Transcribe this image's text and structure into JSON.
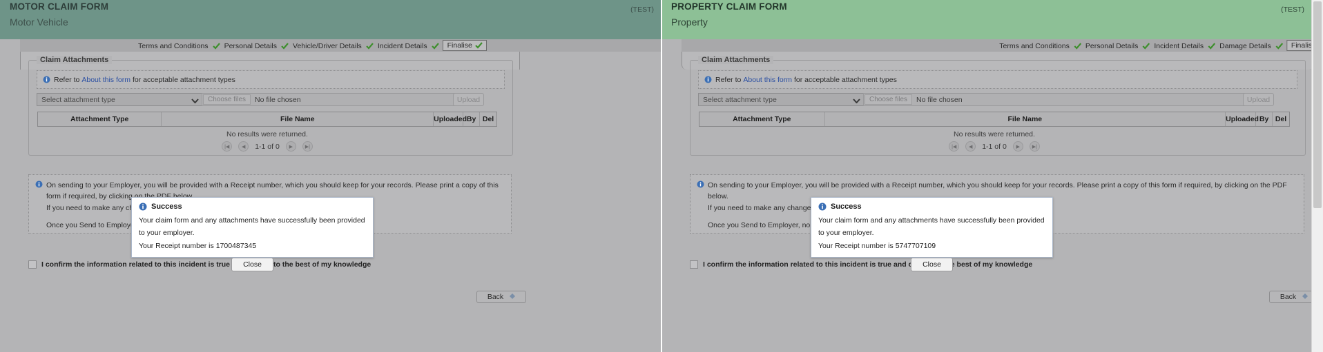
{
  "colors": {
    "motor_header": "#6e9488",
    "property_header": "#8dc096",
    "page_bg": "#b4b4b6",
    "link": "#2b4fa2",
    "tick_green": "#3f8f2e",
    "info_blue": "#3b6fb5"
  },
  "panes": [
    {
      "id": "motor",
      "header": {
        "title": "MOTOR CLAIM FORM",
        "subtitle": "Motor Vehicle",
        "environment_flag": "(TEST)"
      },
      "breadcrumb": {
        "steps": [
          {
            "label": "Terms and Conditions",
            "completed": true,
            "active": false
          },
          {
            "label": "Personal Details",
            "completed": true,
            "active": false
          },
          {
            "label": "Vehicle/Driver Details",
            "completed": true,
            "active": false
          },
          {
            "label": "Incident Details",
            "completed": true,
            "active": false
          },
          {
            "label": "Finalise",
            "completed": true,
            "active": true
          }
        ]
      },
      "attachments": {
        "legend": "Claim Attachments",
        "info_prefix": "Refer to",
        "info_link": "About this form",
        "info_suffix": "for acceptable attachment types",
        "type_select_value": "Select attachment type",
        "file_button_label": "Choose files",
        "file_status": "No file chosen",
        "upload_button_label": "Upload",
        "table": {
          "columns": [
            "Attachment Type",
            "File Name",
            "Uploaded",
            "By",
            "Del"
          ],
          "empty_message": "No results were returned.",
          "pager_text": "1-1 of 0"
        }
      },
      "notice": {
        "line1": "On sending to your Employer, you will be provided with a Receipt number, which you should keep for your records. Please print a copy of this form if required, by clicking on the PDF below.",
        "line2": "If you need to make any changes, you may do so prior to clicking on the Send to Employer button.",
        "line3": "Once you Send to Employer, no further changes can be made."
      },
      "confirm_label": "I confirm the information related to this incident is true and correct to the best of my knowledge",
      "back_button": "Back",
      "dialog": {
        "title": "Success",
        "message": "Your claim form and any attachments have successfully been provided to your employer.",
        "receipt_prefix": "Your Receipt number is",
        "receipt_number": "1700487345",
        "close_label": "Close"
      }
    },
    {
      "id": "property",
      "header": {
        "title": "PROPERTY CLAIM FORM",
        "subtitle": "Property",
        "environment_flag": "(TEST)"
      },
      "breadcrumb": {
        "steps": [
          {
            "label": "Terms and Conditions",
            "completed": true,
            "active": false
          },
          {
            "label": "Personal Details",
            "completed": true,
            "active": false
          },
          {
            "label": "Incident Details",
            "completed": true,
            "active": false
          },
          {
            "label": "Damage Details",
            "completed": true,
            "active": false
          },
          {
            "label": "Finalise",
            "completed": true,
            "active": true
          }
        ]
      },
      "attachments": {
        "legend": "Claim Attachments",
        "info_prefix": "Refer to",
        "info_link": "About this form",
        "info_suffix": "for acceptable attachment types",
        "type_select_value": "Select attachment type",
        "file_button_label": "Choose files",
        "file_status": "No file chosen",
        "upload_button_label": "Upload",
        "table": {
          "columns": [
            "Attachment Type",
            "File Name",
            "Uploaded",
            "By",
            "Del"
          ],
          "empty_message": "No results were returned.",
          "pager_text": "1-1 of 0"
        }
      },
      "notice": {
        "line1": "On sending to your Employer, you will be provided with a Receipt number, which you should keep for your records. Please print a copy of this form if required, by clicking on the PDF below.",
        "line2": "If you need to make any changes, you may do so prior to clicking on the Send to Employer button.",
        "line3": "Once you Send to Employer, no further changes can be made."
      },
      "confirm_label": "I confirm the information related to this incident is true and correct to the best of my knowledge",
      "back_button": "Back",
      "dialog": {
        "title": "Success",
        "message": "Your claim form and any attachments have successfully been provided to your employer.",
        "receipt_prefix": "Your Receipt number is",
        "receipt_number": "5747707109",
        "close_label": "Close"
      }
    }
  ],
  "icons": {
    "tick": "check-tick-icon",
    "info": "info-circle-icon",
    "chevron": "chevron-down-icon",
    "first": "first-page-icon",
    "prev": "previous-page-icon",
    "next": "next-page-icon",
    "last": "last-page-icon",
    "back_arrow": "back-arrow-icon"
  }
}
